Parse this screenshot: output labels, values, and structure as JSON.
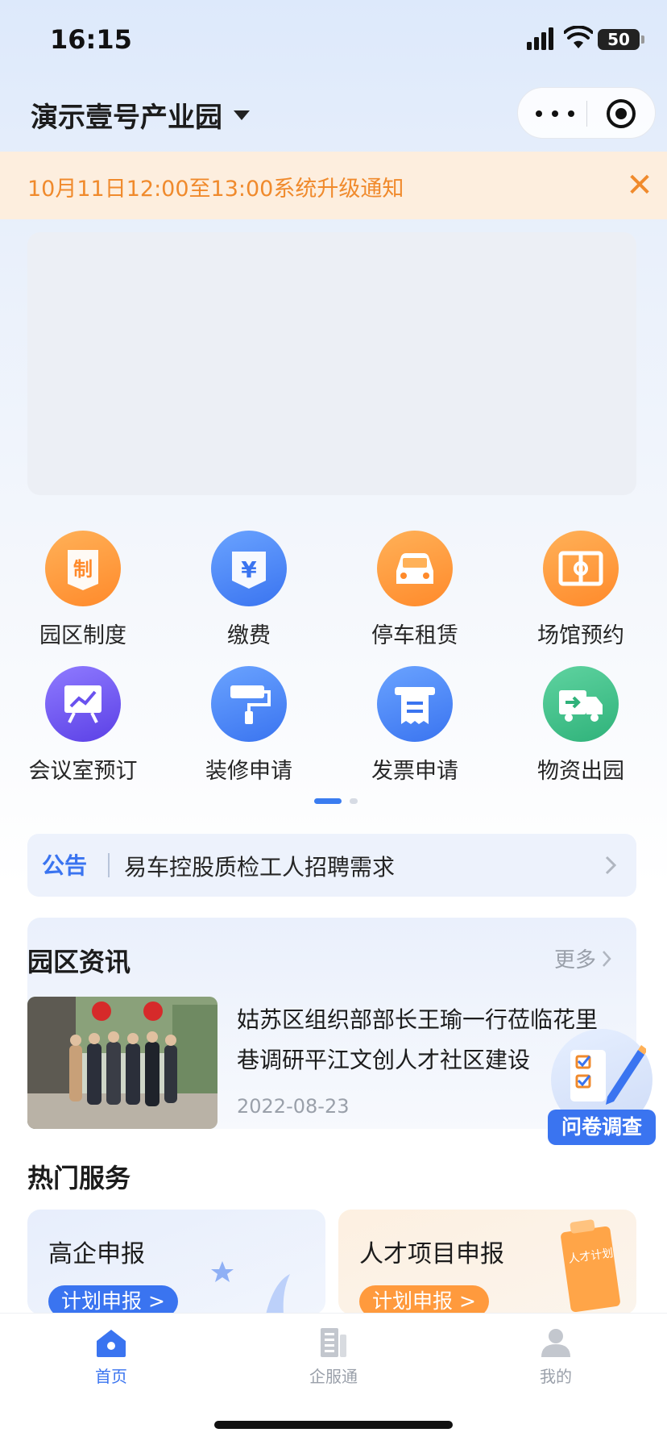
{
  "status_bar": {
    "time": "16:15",
    "battery": "50"
  },
  "header": {
    "title": "演示壹号产业园"
  },
  "notice": {
    "text": "10月11日12:00至13:00系统升级通知",
    "close_glyph": "✕"
  },
  "grid": {
    "items": [
      {
        "label": "园区制度",
        "icon": "regulation-icon"
      },
      {
        "label": "缴费",
        "icon": "yuan-payment-icon"
      },
      {
        "label": "停车租赁",
        "icon": "car-icon"
      },
      {
        "label": "场馆预约",
        "icon": "court-icon"
      },
      {
        "label": "会议室预订",
        "icon": "presentation-icon"
      },
      {
        "label": "装修申请",
        "icon": "paint-roller-icon"
      },
      {
        "label": "发票申请",
        "icon": "invoice-icon"
      },
      {
        "label": "物资出园",
        "icon": "truck-icon"
      }
    ],
    "icon_glyphs": {
      "regulation": "制",
      "yuan": "¥"
    }
  },
  "announcement": {
    "tag": "公告",
    "text": "易车控股质检工人招聘需求"
  },
  "news": {
    "section_title": "园区资讯",
    "more_label": "更多",
    "items": [
      {
        "headline": "姑苏区组织部部长王瑜一行莅临花里巷调研平江文创人才社区建设",
        "date": "2022-08-23"
      }
    ]
  },
  "survey": {
    "label": "问卷调查"
  },
  "hot_services": {
    "title": "热门服务",
    "cards": [
      {
        "name": "高企申报",
        "button": "计划申报 >"
      },
      {
        "name": "人才项目申报",
        "button": "计划申报 >",
        "tag": "人才计划"
      }
    ]
  },
  "tab_bar": {
    "items": [
      {
        "label": "首页",
        "active": true
      },
      {
        "label": "企服通",
        "active": false
      },
      {
        "label": "我的",
        "active": false
      }
    ]
  },
  "colors": {
    "primary": "#3a74f0",
    "notice_text": "#f08a2c",
    "notice_bg": "#fdeede",
    "orange": "#ff8a2b"
  }
}
